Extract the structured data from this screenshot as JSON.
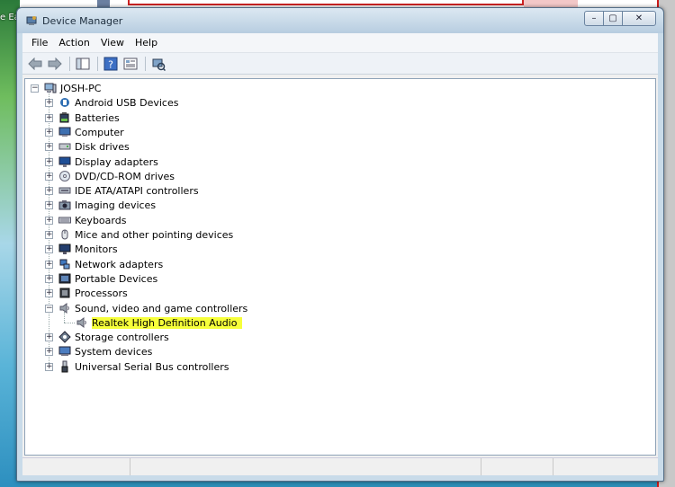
{
  "desktop": {
    "left_text": "e Ea"
  },
  "window": {
    "title": "Device Manager",
    "menu": [
      "File",
      "Action",
      "View",
      "Help"
    ],
    "caption": {
      "minimize": "–",
      "maximize": "▢",
      "close": "✕"
    }
  },
  "tree": {
    "root": "JOSH-PC",
    "categories": [
      {
        "label": "Android USB Devices",
        "icon": "usb-icon"
      },
      {
        "label": "Batteries",
        "icon": "battery-icon"
      },
      {
        "label": "Computer",
        "icon": "computer-icon"
      },
      {
        "label": "Disk drives",
        "icon": "disk-icon"
      },
      {
        "label": "Display adapters",
        "icon": "display-icon"
      },
      {
        "label": "DVD/CD-ROM drives",
        "icon": "dvd-icon"
      },
      {
        "label": "IDE ATA/ATAPI controllers",
        "icon": "ide-icon"
      },
      {
        "label": "Imaging devices",
        "icon": "camera-icon"
      },
      {
        "label": "Keyboards",
        "icon": "keyboard-icon"
      },
      {
        "label": "Mice and other pointing devices",
        "icon": "mouse-icon"
      },
      {
        "label": "Monitors",
        "icon": "monitor-icon"
      },
      {
        "label": "Network adapters",
        "icon": "network-icon"
      },
      {
        "label": "Portable Devices",
        "icon": "portable-icon"
      },
      {
        "label": "Processors",
        "icon": "processor-icon"
      },
      {
        "label": "Sound, video and game controllers",
        "icon": "speaker-icon",
        "expanded": true
      },
      {
        "label": "Storage controllers",
        "icon": "storage-icon"
      },
      {
        "label": "System devices",
        "icon": "system-icon"
      },
      {
        "label": "Universal Serial Bus controllers",
        "icon": "usb-plug-icon"
      }
    ],
    "child": {
      "label": "Realtek High Definition Audio",
      "icon": "speaker-icon"
    }
  },
  "colors": {
    "highlight": "#f6ff3a"
  }
}
